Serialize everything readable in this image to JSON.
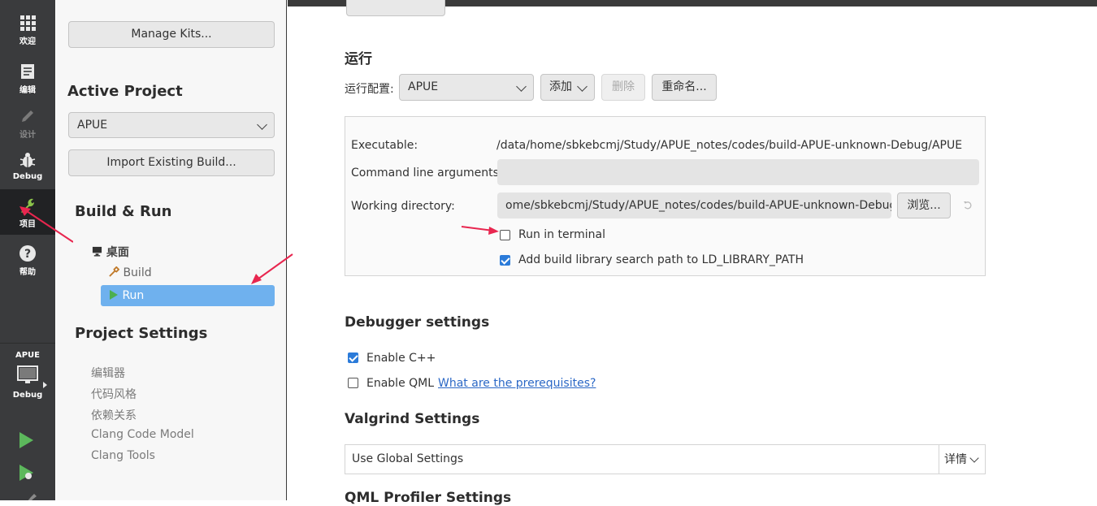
{
  "modes": [
    {
      "label": "欢迎",
      "icon": "grid-icon"
    },
    {
      "label": "编辑",
      "icon": "document-icon"
    },
    {
      "label": "设计",
      "icon": "pencil-icon"
    },
    {
      "label": "Debug",
      "icon": "bug-icon"
    },
    {
      "label": "项目",
      "icon": "wrench-icon"
    },
    {
      "label": "帮助",
      "icon": "help-icon"
    }
  ],
  "target": {
    "project": "APUE",
    "config": "Debug"
  },
  "sidebar": {
    "manage_kits": "Manage Kits...",
    "active_project_heading": "Active Project",
    "active_project": "APUE",
    "import_build": "Import Existing Build...",
    "build_run_heading": "Build & Run",
    "kit_name": "桌面",
    "build_item": "Build",
    "run_item": "Run",
    "project_settings_heading": "Project Settings",
    "settings_items": [
      "编辑器",
      "代码风格",
      "依赖关系",
      "Clang Code Model",
      "Clang Tools"
    ]
  },
  "main": {
    "run_section_title": "运行",
    "run_config_label": "运行配置:",
    "run_config_value": "APUE",
    "add_label": "添加",
    "delete_label": "删除",
    "rename_label": "重命名...",
    "executable_label": "Executable:",
    "executable_value": "/data/home/sbkebcmj/Study/APUE_notes/codes/build-APUE-unknown-Debug/APUE",
    "args_label": "Command line arguments:",
    "args_value": "",
    "workdir_label": "Working directory:",
    "workdir_value": "ome/sbkebcmj/Study/APUE_notes/codes/build-APUE-unknown-Debug",
    "browse_label": "浏览...",
    "run_in_terminal_label": "Run in terminal",
    "run_in_terminal_checked": false,
    "add_lib_path_label": "Add build library search path to LD_LIBRARY_PATH",
    "add_lib_path_checked": true,
    "debugger_title": "Debugger settings",
    "enable_cpp_label": "Enable C++",
    "enable_qml_label": "Enable QML",
    "prereq_link": "What are the prerequisites?",
    "valgrind_title": "Valgrind Settings",
    "valgrind_value": "Use Global Settings",
    "details_label": "详情",
    "qml_profiler_title": "QML Profiler Settings"
  },
  "colors": {
    "accent": "#6fb1ee",
    "annotation": "#e8264f",
    "modebar": "#3a3b3d"
  }
}
